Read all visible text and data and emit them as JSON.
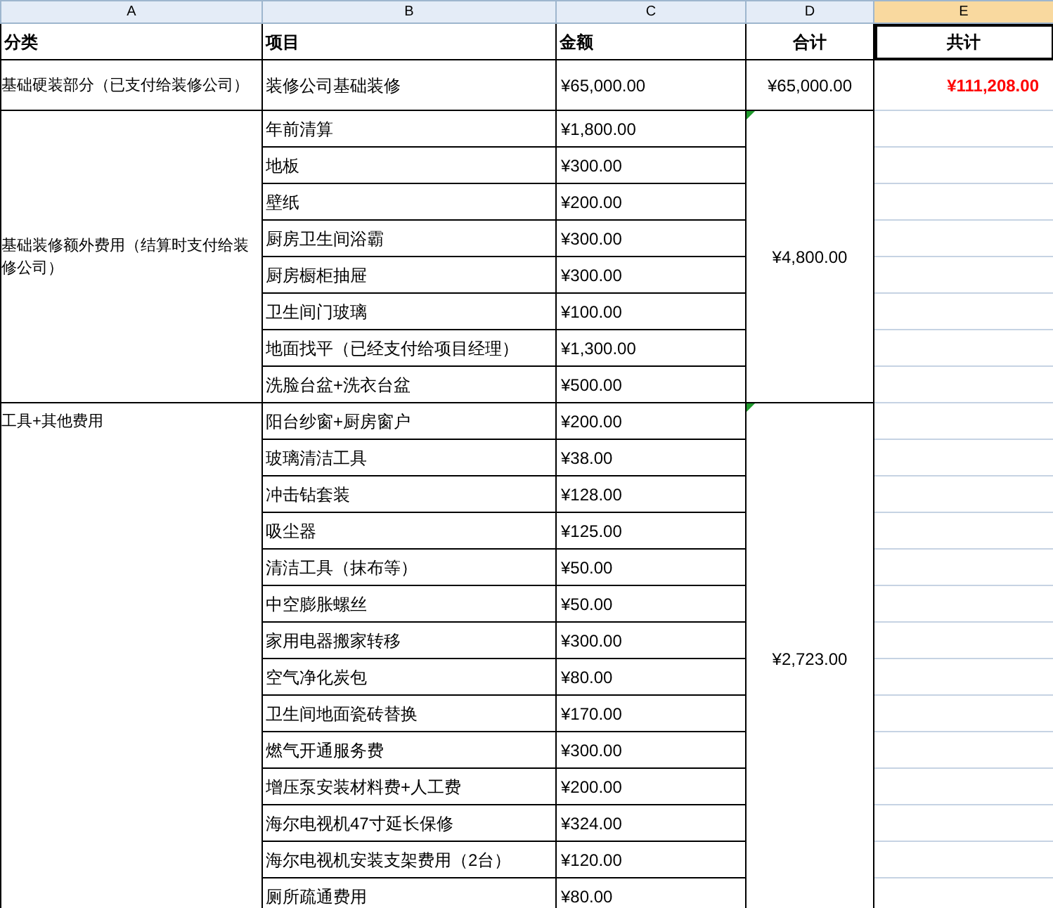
{
  "columns": [
    {
      "label": "A",
      "selected": false
    },
    {
      "label": "B",
      "selected": false
    },
    {
      "label": "C",
      "selected": false
    },
    {
      "label": "D",
      "selected": false
    },
    {
      "label": "E",
      "selected": true
    }
  ],
  "header_row": [
    {
      "text": "分类",
      "selected": false
    },
    {
      "text": "项目",
      "selected": false
    },
    {
      "text": "金额",
      "selected": false
    },
    {
      "text": "合计",
      "selected": false
    },
    {
      "text": "共计",
      "selected": true
    }
  ],
  "grand_total": "¥111,208.00",
  "groups": [
    {
      "category": "基础硬装部分（已支付给装修公司）",
      "subtotal": "¥65,000.00",
      "flagged": false,
      "items": [
        {
          "item": "装修公司基础装修",
          "amount": "¥65,000.00"
        }
      ]
    },
    {
      "category": "基础装修额外费用（结算时支付给装修公司）",
      "subtotal": "¥4,800.00",
      "flagged": true,
      "items": [
        {
          "item": "年前清算",
          "amount": "¥1,800.00"
        },
        {
          "item": "地板",
          "amount": "¥300.00"
        },
        {
          "item": "壁纸",
          "amount": "¥200.00"
        },
        {
          "item": "厨房卫生间浴霸",
          "amount": "¥300.00"
        },
        {
          "item": "厨房橱柜抽屉",
          "amount": "¥300.00"
        },
        {
          "item": "卫生间门玻璃",
          "amount": "¥100.00"
        },
        {
          "item": "地面找平（已经支付给项目经理）",
          "amount": "¥1,300.00"
        },
        {
          "item": "洗脸台盆+洗衣台盆",
          "amount": "¥500.00"
        }
      ]
    },
    {
      "category": "工具+其他费用",
      "subtotal": "¥2,723.00",
      "flagged": true,
      "items": [
        {
          "item": "阳台纱窗+厨房窗户",
          "amount": "¥200.00"
        },
        {
          "item": "玻璃清洁工具",
          "amount": "¥38.00"
        },
        {
          "item": "冲击钻套装",
          "amount": "¥128.00"
        },
        {
          "item": "吸尘器",
          "amount": "¥125.00"
        },
        {
          "item": "清洁工具（抹布等）",
          "amount": "¥50.00"
        },
        {
          "item": "中空膨胀螺丝",
          "amount": "¥50.00"
        },
        {
          "item": "家用电器搬家转移",
          "amount": "¥300.00"
        },
        {
          "item": "空气净化炭包",
          "amount": "¥80.00"
        },
        {
          "item": "卫生间地面瓷砖替换",
          "amount": "¥170.00"
        },
        {
          "item": "燃气开通服务费",
          "amount": "¥300.00"
        },
        {
          "item": "增压泵安装材料费+人工费",
          "amount": "¥200.00"
        },
        {
          "item": "海尔电视机47寸延长保修",
          "amount": "¥324.00"
        },
        {
          "item": "海尔电视机安装支架费用（2台）",
          "amount": "¥120.00"
        },
        {
          "item": "厕所疏通费用",
          "amount": "¥80.00"
        }
      ]
    }
  ]
}
